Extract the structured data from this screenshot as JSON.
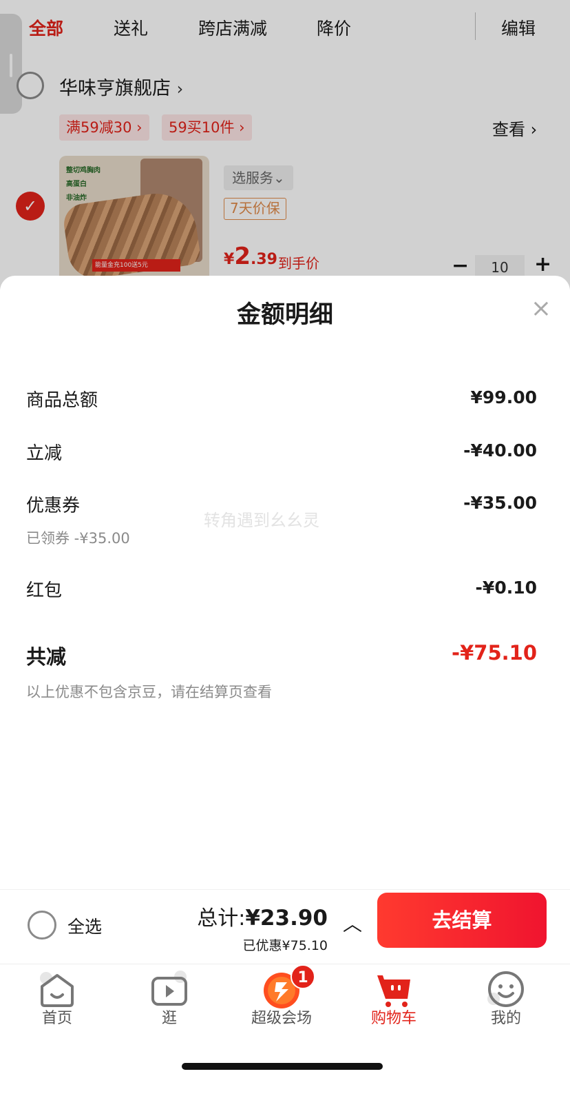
{
  "tabs": {
    "items": [
      "全部",
      "送礼",
      "跨店满减",
      "降价"
    ],
    "edit": "编辑"
  },
  "store": {
    "name": "华味亨旗舰店",
    "promos": [
      "满59减30 ›",
      "59买10件 ›"
    ],
    "view": "查看 ›"
  },
  "product": {
    "service": "选服务⌄",
    "guarantee": "7天价保",
    "price_currency": "¥",
    "price_int": "2",
    "price_dec": ".39",
    "price_note": "到手价",
    "quantity": "10",
    "minus": "−",
    "plus": "+",
    "image_features": [
      "整切鸡胸肉",
      "高蛋白",
      "非油炸"
    ],
    "image_banner": "能量金充100送5元"
  },
  "sheet": {
    "title": "金额明细",
    "rows": [
      {
        "label": "商品总额",
        "value": "¥99.00"
      },
      {
        "label": "立减",
        "value": "-¥40.00"
      },
      {
        "label": "优惠券",
        "value": "-¥35.00",
        "sub": "已领券 -¥35.00"
      },
      {
        "label": "红包",
        "value": "-¥0.10"
      }
    ],
    "total_label": "共减",
    "total_value": "-¥75.10",
    "note": "以上优惠不包含京豆，请在结算页查看",
    "watermark": "转角遇到幺幺灵"
  },
  "checkout": {
    "select_all": "全选",
    "total_prefix": "总计:",
    "total_amount": "¥23.90",
    "saved": "已优惠¥75.10",
    "button": "去结算"
  },
  "tabbar": {
    "items": [
      {
        "label": "首页",
        "icon": "home-icon"
      },
      {
        "label": "逛",
        "icon": "play-icon"
      },
      {
        "label": "超级会场",
        "icon": "super-venue-icon"
      },
      {
        "label": "购物车",
        "icon": "cart-icon"
      },
      {
        "label": "我的",
        "icon": "profile-icon"
      }
    ],
    "badge": "1"
  },
  "colors": {
    "accent": "#e2231a",
    "muted": "#8a8a8a"
  }
}
